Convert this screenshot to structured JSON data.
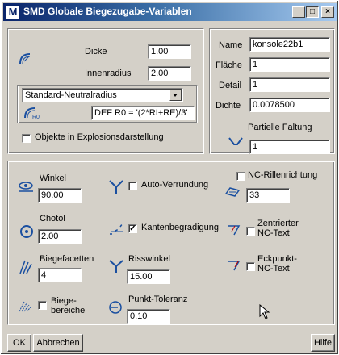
{
  "window": {
    "title": "SMD Globale Biegezugabe-Variablen",
    "logo_letter": "M",
    "minimize": "_",
    "maximize": "□",
    "close": "×"
  },
  "top_left": {
    "dicke_label": "Dicke",
    "dicke_value": "1.00",
    "innenradius_label": "Innenradius",
    "innenradius_value": "2.00",
    "neutralradius_select": "Standard-Neutralradius",
    "formula_value": "DEF R0 = '(2*RI+RE)/3'",
    "explosion_label": "Objekte in Explosionsdarstellung"
  },
  "top_right": {
    "name_label": "Name",
    "name_value": "konsole22b1",
    "flaeche_label": "Fläche",
    "flaeche_value": "1",
    "detail_label": "Detail",
    "detail_value": "1",
    "dichte_label": "Dichte",
    "dichte_value": "0.0078500",
    "partielle_label": "Partielle Faltung",
    "partielle_value": "1"
  },
  "params": {
    "winkel_label": "Winkel",
    "winkel_value": "90.00",
    "chotol_label": "Chotol",
    "chotol_value": "2.00",
    "biegefacetten_label": "Biegefacetten",
    "biegefacetten_value": "4",
    "biegebereiche_label_1": "Biege-",
    "biegebereiche_label_2": "bereiche",
    "auto_verrundung_label": "Auto-Verrundung",
    "kantenbegradigung_label": "Kantenbegradigung",
    "kantenbegradigung_check": "✓",
    "risswinkel_label": "Risswinkel",
    "risswinkel_value": "15.00",
    "punkt_toleranz_label": "Punkt-Toleranz",
    "punkt_toleranz_value": "0.10",
    "nc_rillen_label": "NC-Rillenrichtung",
    "nc_rillen_value": "33",
    "zentrierter_label_1": "Zentrierter",
    "zentrierter_label_2": "NC-Text",
    "eckpunkt_label_1": "Eckpunkt-",
    "eckpunkt_label_2": "NC-Text"
  },
  "buttons": {
    "ok": "OK",
    "abbrechen": "Abbrechen",
    "hilfe": "Hilfe"
  },
  "colors": {
    "title_start": "#0a246a",
    "title_end": "#a6caf0",
    "icon_blue": "#1a4fa0",
    "dialog_gray": "#d4d0c8"
  }
}
